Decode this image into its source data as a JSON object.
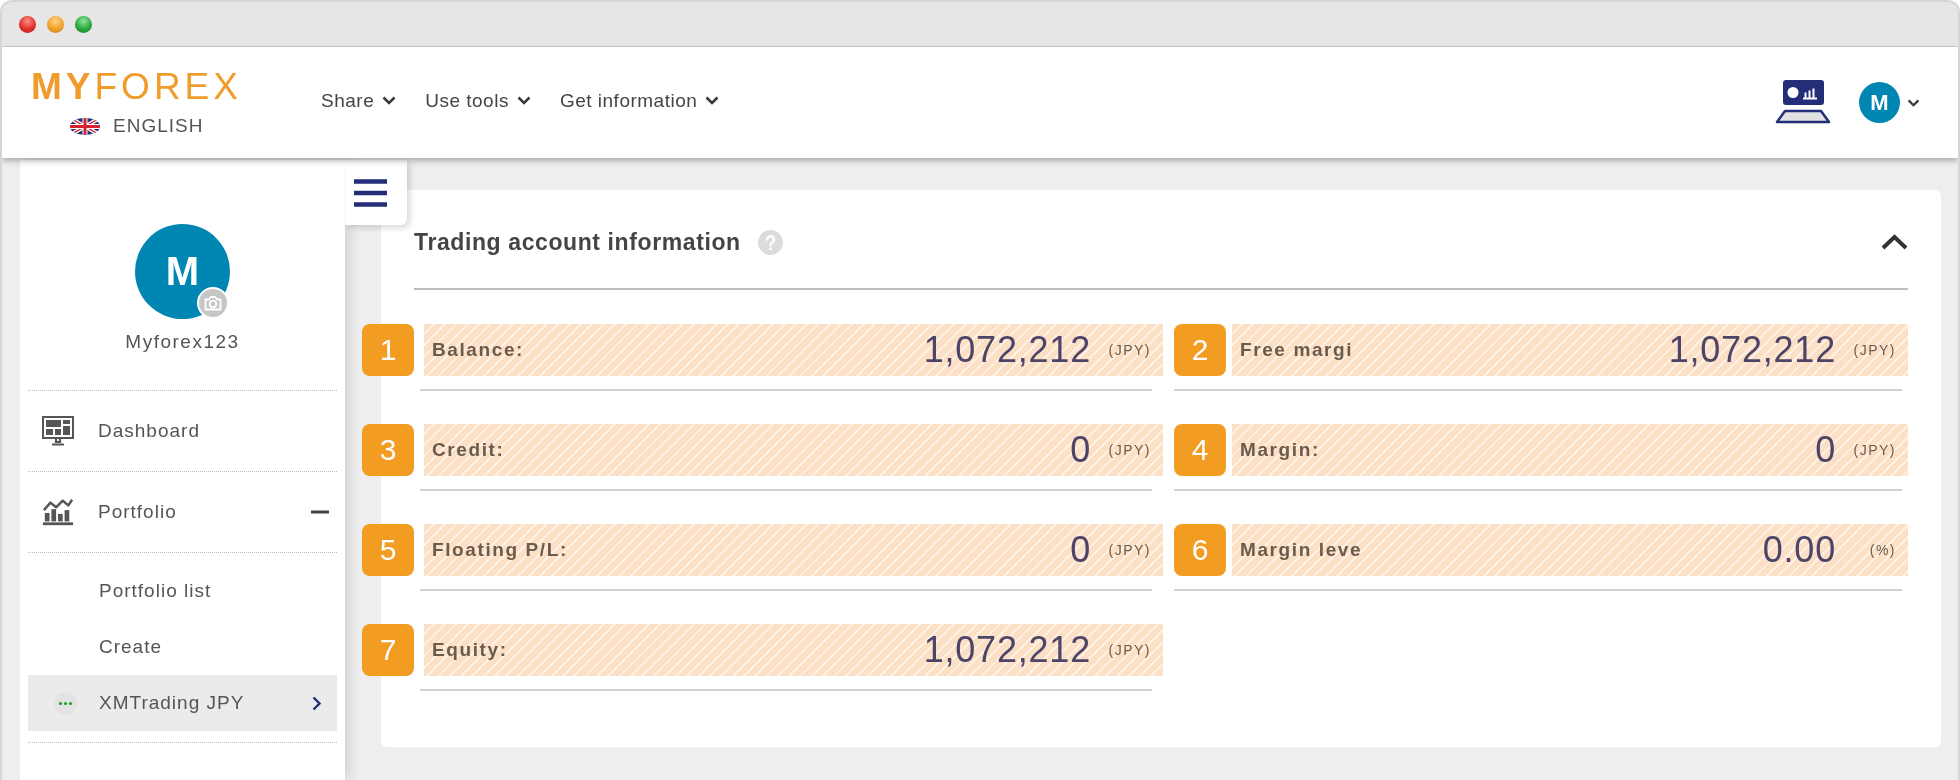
{
  "header": {
    "logo": "**MY**FOREX",
    "language": "ENGLISH",
    "nav": [
      {
        "label": "Share"
      },
      {
        "label": "Use tools"
      },
      {
        "label": "Get information"
      }
    ],
    "user_avatar": "M"
  },
  "sidebar": {
    "avatar": "M",
    "username": "Myforex123",
    "items": [
      {
        "label": "Dashboard",
        "selected": false
      },
      {
        "label": "Portfolio",
        "selected": false,
        "expanded": true,
        "children": [
          {
            "label": "Portfolio list",
            "kind": "link",
            "selected": false
          },
          {
            "label": "Create",
            "kind": "link",
            "selected": false
          },
          {
            "label": "XMTrading JPY",
            "kind": "account",
            "selected": true
          }
        ]
      }
    ]
  },
  "account_panel": {
    "title": "Trading account information",
    "expanded": true,
    "items": [
      {
        "number": "1",
        "label": "Balance:",
        "value": "1,072,212",
        "unit": "(JPY)"
      },
      {
        "number": "2",
        "label": "Free margi",
        "value": "1,072,212",
        "unit": "(JPY)"
      },
      {
        "number": "3",
        "label": "Credit:",
        "value": "0",
        "unit": "(JPY)"
      },
      {
        "number": "4",
        "label": "Margin:",
        "value": "0",
        "unit": "(JPY)"
      },
      {
        "number": "5",
        "label": "Floating P/L:",
        "value": "0",
        "unit": "(JPY)"
      },
      {
        "number": "6",
        "label": "Margin leve",
        "value": "0.00",
        "unit": "(%)"
      },
      {
        "number": "7",
        "label": "Equity:",
        "value": "1,072,212",
        "unit": "(JPY)"
      }
    ]
  }
}
